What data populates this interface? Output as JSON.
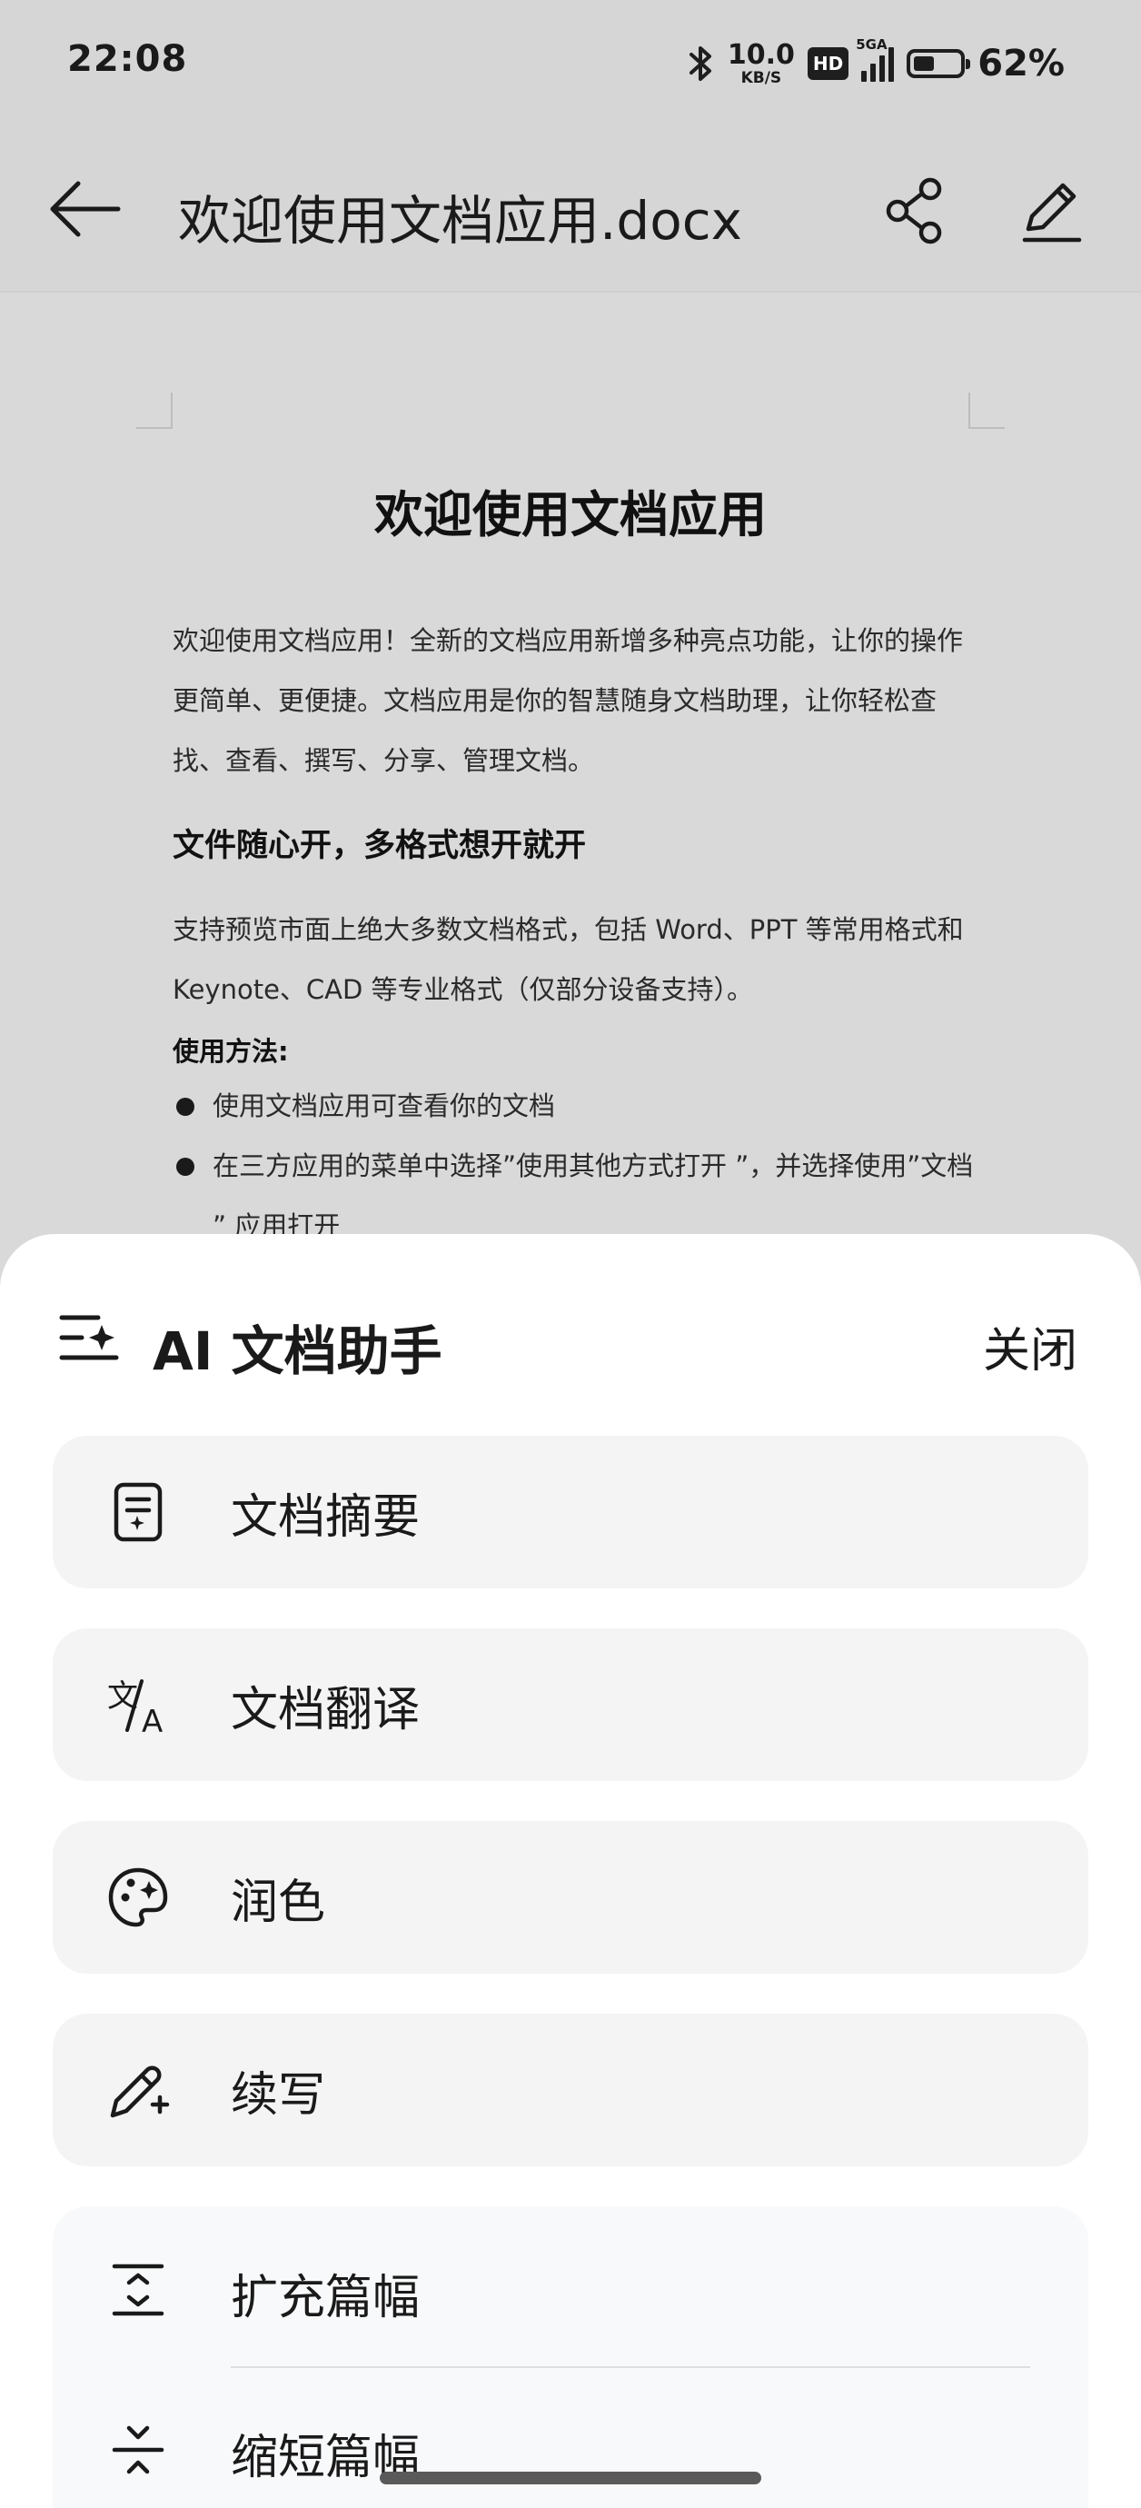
{
  "status_bar": {
    "time": "22:08",
    "net_speed_value": "10.0",
    "net_speed_unit": "KB/S",
    "hd_badge": "HD",
    "network_type": "5GA",
    "battery_percent": "62%",
    "battery_level": 0.62,
    "icons": [
      "bluetooth-icon",
      "signal-icon",
      "battery-icon"
    ]
  },
  "app_bar": {
    "title": "欢迎使用文档应用.docx",
    "icons": [
      "back-arrow-icon",
      "share-icon",
      "edit-pencil-icon"
    ]
  },
  "document": {
    "heading": "欢迎使用文档应用",
    "intro": "欢迎使用文档应用！全新的文档应用新增多种亮点功能，让你的操作更简单、更便捷。文档应用是你的智慧随身文档助理，让你轻松查找、查看、撰写、分享、管理文档。",
    "section_title": "文件随心开，多格式想开就开",
    "section_body": "支持预览市面上绝大多数文档格式，包括 Word、PPT 等常用格式和 Keynote、CAD 等专业格式（仅部分设备支持）。",
    "usage_label": "使用方法:",
    "bullets": [
      "使用文档应用可查看你的文档",
      "在三方应用的菜单中选择”使用其他方式打开 ”，并选择使用”文档 ” 应用打开"
    ]
  },
  "assistant_sheet": {
    "title": "AI 文档助手",
    "close_label": "关闭",
    "actions": [
      {
        "label": "文档摘要",
        "icon": "document-summary-icon"
      },
      {
        "label": "文档翻译",
        "icon": "translate-icon"
      },
      {
        "label": "润色",
        "icon": "palette-icon"
      },
      {
        "label": "续写",
        "icon": "pencil-plus-icon"
      },
      {
        "label": "扩充篇幅",
        "icon": "expand-icon"
      },
      {
        "label": "缩短篇幅",
        "icon": "shrink-icon"
      }
    ]
  }
}
